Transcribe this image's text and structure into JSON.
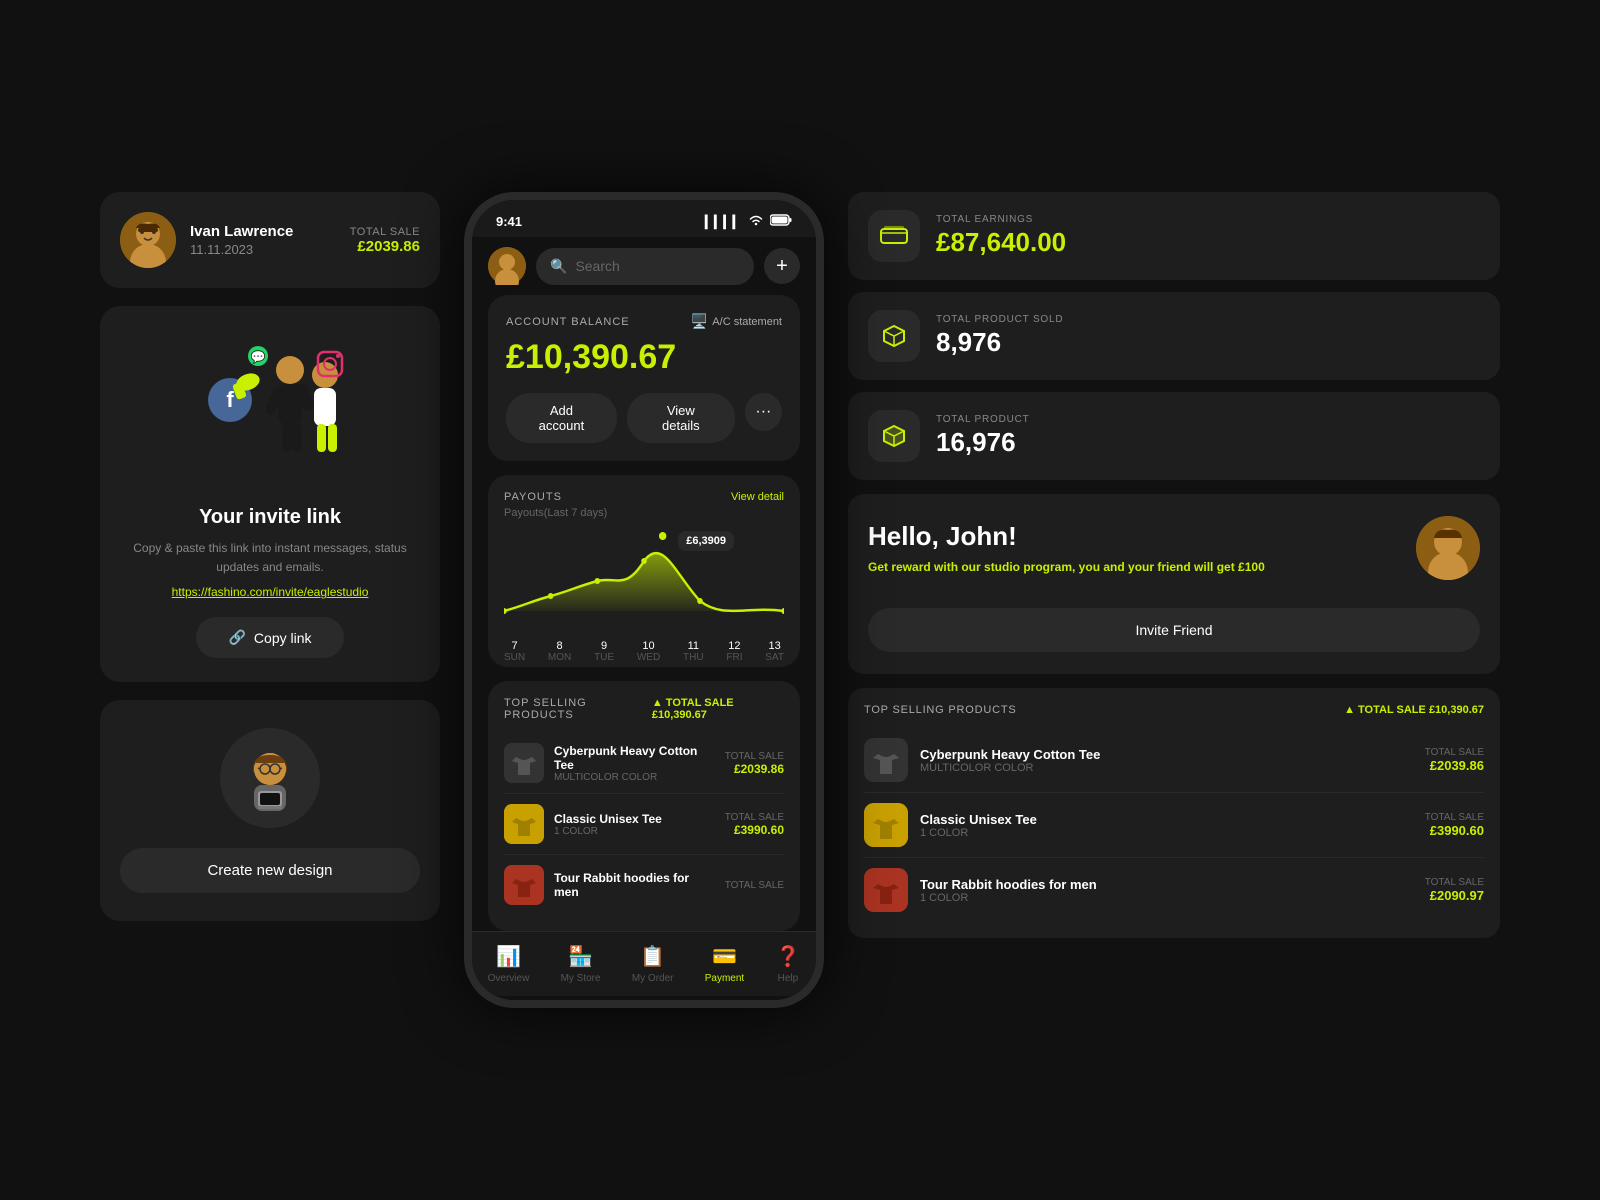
{
  "user": {
    "name": "Ivan Lawrence",
    "date": "11.11.2023",
    "total_sale_label": "TOTAL SALE",
    "total_sale_value": "£2039.86"
  },
  "invite": {
    "title": "Your invite link",
    "description": "Copy & paste this link into instant messages, status updates and emails.",
    "link": "https://fashino.com/invite/eaglestudio",
    "copy_button": "Copy link"
  },
  "design": {
    "button": "Create new design"
  },
  "search": {
    "placeholder": "Search"
  },
  "balance": {
    "label": "ACCOUNT BALANCE",
    "ac_statement": "A/C statement",
    "amount": "£10,390.67",
    "add_account": "Add account",
    "view_details": "View details",
    "more": "···"
  },
  "payouts": {
    "title": "PAYOUTS",
    "subtitle": "Payouts(Last 7 days)",
    "view_detail": "View detail",
    "tooltip": "£6,3909",
    "days": [
      {
        "num": "7",
        "name": "SUN"
      },
      {
        "num": "8",
        "name": "MON"
      },
      {
        "num": "9",
        "name": "TUE"
      },
      {
        "num": "10",
        "name": "WED"
      },
      {
        "num": "11",
        "name": "THU"
      },
      {
        "num": "12",
        "name": "FRI"
      },
      {
        "num": "13",
        "name": "SAT"
      }
    ]
  },
  "top_selling": {
    "title": "TOP SELLING PRODUCTS",
    "total_sale_label": "TOTAL SALE",
    "total_sale_value": "£10,390.67",
    "products": [
      {
        "name": "Cyberpunk Heavy Cotton Tee",
        "color": "MULTICOLOR COLOR",
        "sale_label": "TOTAL SALE",
        "sale_value": "£2039.86",
        "thumb_type": "dark"
      },
      {
        "name": "Classic Unisex Tee",
        "color": "1 COLOR",
        "sale_label": "TOTAL SALE",
        "sale_value": "£3990.60",
        "thumb_type": "yellow"
      },
      {
        "name": "Tour Rabbit hoodies for men",
        "color": "",
        "sale_label": "TOTAL SALE",
        "sale_value": "",
        "thumb_type": "red"
      }
    ]
  },
  "bottom_nav": [
    {
      "label": "Overview",
      "icon": "📊",
      "active": false
    },
    {
      "label": "My Store",
      "icon": "🏪",
      "active": false
    },
    {
      "label": "My Order",
      "icon": "📋",
      "active": false
    },
    {
      "label": "Payment",
      "icon": "💳",
      "active": true
    },
    {
      "label": "Help",
      "icon": "❓",
      "active": false
    }
  ],
  "stats": [
    {
      "label": "TOTAL EARNINGS",
      "value": "£87,640.00",
      "icon": "💳",
      "yellow": true
    },
    {
      "label": "TOTAL PRODUCT SOLD",
      "value": "8,976",
      "icon": "📦",
      "yellow": false
    },
    {
      "label": "TOTAL PRODUCT",
      "value": "16,976",
      "icon": "🧊",
      "yellow": false
    }
  ],
  "hello": {
    "title": "Hello, John!",
    "description": "Get reward with our studio program, you and your friend will get",
    "reward": "£100",
    "invite_btn": "Invite Friend"
  },
  "right_products": {
    "title": "TOP SELLING PRODUCTS",
    "total_sale_label": "TOTAL SALE",
    "total_sale_value": "£10,390.67",
    "products": [
      {
        "name": "Cyberpunk Heavy Cotton Tee",
        "color": "MULTICOLOR COLOR",
        "sale_label": "TOTAL SALE",
        "sale_value": "£2039.86",
        "thumb_type": "dark"
      },
      {
        "name": "Classic Unisex Tee",
        "color": "1 COLOR",
        "sale_label": "TOTAL SALE",
        "sale_value": "£3990.60",
        "thumb_type": "yellow"
      },
      {
        "name": "Tour Rabbit hoodies for men",
        "color": "1 COLOR",
        "sale_label": "TOTAL SALE",
        "sale_value": "£2090.97",
        "thumb_type": "red"
      }
    ]
  },
  "status_bar": {
    "time": "9:41",
    "signal": "▐▐▐▐",
    "wifi": "WiFi",
    "battery": "🔋"
  }
}
